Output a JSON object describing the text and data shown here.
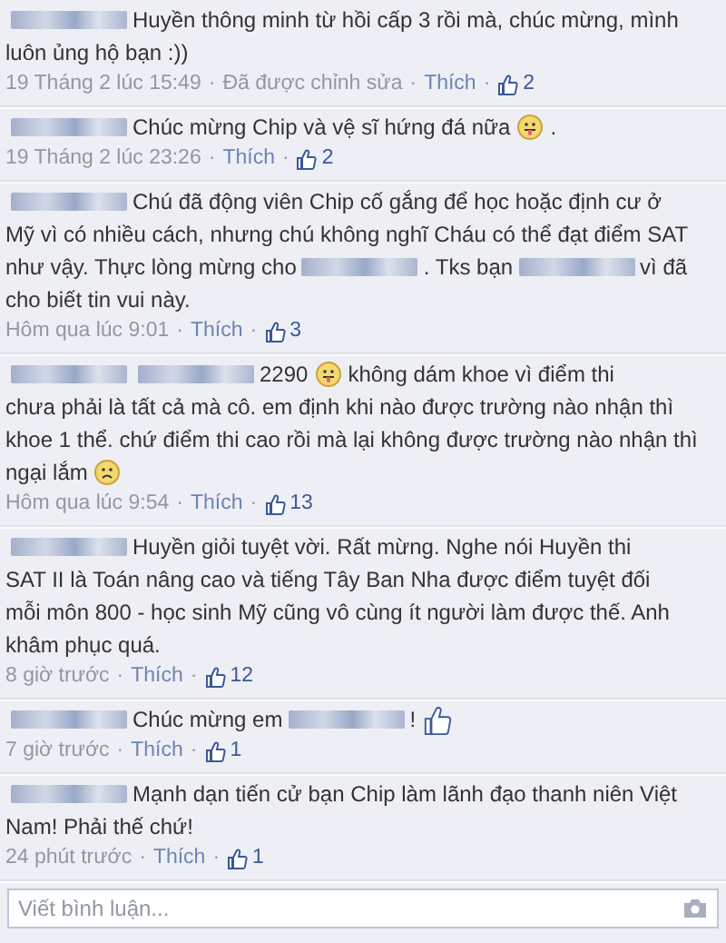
{
  "comments": [
    {
      "lines": [
        [
          {
            "kind": "blur"
          },
          {
            "kind": "text",
            "text": "Huyền thông minh từ hồi cấp 3 rồi mà, chúc mừng, mình"
          }
        ],
        [
          {
            "kind": "text",
            "text": "luôn ủng hộ bạn :))"
          }
        ]
      ],
      "meta": [
        {
          "kind": "time",
          "text": "19 Tháng 2 lúc 15:49"
        },
        {
          "kind": "dot",
          "text": "·"
        },
        {
          "kind": "note",
          "text": "Đã được chỉnh sửa"
        },
        {
          "kind": "dot",
          "text": "·"
        },
        {
          "kind": "like",
          "text": "Thích"
        },
        {
          "kind": "dot",
          "text": "·"
        },
        {
          "kind": "count",
          "text": "2"
        }
      ]
    },
    {
      "lines": [
        [
          {
            "kind": "blur"
          },
          {
            "kind": "text",
            "text": "Chúc mừng Chip và vệ sĩ hứng đá nữa"
          },
          {
            "kind": "tongue"
          },
          {
            "kind": "text",
            "text": "."
          }
        ]
      ],
      "meta": [
        {
          "kind": "time",
          "text": "19 Tháng 2 lúc 23:26"
        },
        {
          "kind": "dot",
          "text": "·"
        },
        {
          "kind": "like",
          "text": "Thích"
        },
        {
          "kind": "dot",
          "text": "·"
        },
        {
          "kind": "count",
          "text": "2"
        }
      ]
    },
    {
      "lines": [
        [
          {
            "kind": "blur"
          },
          {
            "kind": "text",
            "text": "Chú đã động viên Chip cố gắng để học hoặc định cư ở"
          }
        ],
        [
          {
            "kind": "text",
            "text": "Mỹ vì có nhiều cách, nhưng chú không nghĩ Cháu có thể đạt điểm SAT"
          }
        ],
        [
          {
            "kind": "text",
            "text": "như vậy. Thực lòng mừng cho"
          },
          {
            "kind": "blur"
          },
          {
            "kind": "text",
            "text": ". Tks bạn"
          },
          {
            "kind": "blur"
          },
          {
            "kind": "text",
            "text": "vì đã"
          }
        ],
        [
          {
            "kind": "text",
            "text": "cho biết tin vui này."
          }
        ]
      ],
      "meta": [
        {
          "kind": "time",
          "text": "Hôm qua lúc 9:01"
        },
        {
          "kind": "dot",
          "text": "·"
        },
        {
          "kind": "like",
          "text": "Thích"
        },
        {
          "kind": "dot",
          "text": "·"
        },
        {
          "kind": "count",
          "text": "3"
        }
      ]
    },
    {
      "lines": [
        [
          {
            "kind": "blur"
          },
          {
            "kind": "blur"
          },
          {
            "kind": "text",
            "text": "2290"
          },
          {
            "kind": "tongue"
          },
          {
            "kind": "text",
            "text": "không dám khoe vì điểm thi"
          }
        ],
        [
          {
            "kind": "text",
            "text": "chưa phải là tất cả mà cô. em định khi nào được trường nào nhận thì"
          }
        ],
        [
          {
            "kind": "text",
            "text": "khoe 1 thể. chứ điểm thi cao rồi mà lại không được trường nào nhận thì"
          }
        ],
        [
          {
            "kind": "text",
            "text": "ngại lắm"
          },
          {
            "kind": "frown"
          }
        ]
      ],
      "meta": [
        {
          "kind": "time",
          "text": "Hôm qua lúc 9:54"
        },
        {
          "kind": "dot",
          "text": "·"
        },
        {
          "kind": "like",
          "text": "Thích"
        },
        {
          "kind": "dot",
          "text": "·"
        },
        {
          "kind": "count",
          "text": "13"
        }
      ]
    },
    {
      "lines": [
        [
          {
            "kind": "blur"
          },
          {
            "kind": "text",
            "text": "Huyền giỏi tuyệt vời. Rất mừng. Nghe nói Huyền thi"
          }
        ],
        [
          {
            "kind": "text",
            "text": "SAT II là Toán nâng cao và tiếng Tây Ban Nha được điểm tuyệt đối"
          }
        ],
        [
          {
            "kind": "text",
            "text": "mỗi môn 800 - học sinh Mỹ cũng vô cùng ít người làm được thế. Anh"
          }
        ],
        [
          {
            "kind": "text",
            "text": "khâm phục quá."
          }
        ]
      ],
      "meta": [
        {
          "kind": "time",
          "text": "8 giờ trước"
        },
        {
          "kind": "dot",
          "text": "·"
        },
        {
          "kind": "like",
          "text": "Thích"
        },
        {
          "kind": "dot",
          "text": "·"
        },
        {
          "kind": "count",
          "text": "12"
        }
      ]
    },
    {
      "lines": [
        [
          {
            "kind": "blur"
          },
          {
            "kind": "text",
            "text": "Chúc mừng em"
          },
          {
            "kind": "blur"
          },
          {
            "kind": "text",
            "text": "!"
          },
          {
            "kind": "thumb"
          }
        ]
      ],
      "meta": [
        {
          "kind": "time",
          "text": "7 giờ trước"
        },
        {
          "kind": "dot",
          "text": "·"
        },
        {
          "kind": "like",
          "text": "Thích"
        },
        {
          "kind": "dot",
          "text": "·"
        },
        {
          "kind": "count",
          "text": "1"
        }
      ]
    },
    {
      "lines": [
        [
          {
            "kind": "blur"
          },
          {
            "kind": "text",
            "text": "Mạnh dạn tiến cử bạn Chip làm lãnh đạo thanh niên Việt"
          }
        ],
        [
          {
            "kind": "text",
            "text": "Nam! Phải thế chứ!"
          }
        ]
      ],
      "meta": [
        {
          "kind": "time",
          "text": "24 phút trước"
        },
        {
          "kind": "dot",
          "text": "·"
        },
        {
          "kind": "like",
          "text": "Thích"
        },
        {
          "kind": "dot",
          "text": "·"
        },
        {
          "kind": "count",
          "text": "1"
        }
      ]
    }
  ],
  "comment_box": {
    "placeholder": "Viết bình luận..."
  }
}
